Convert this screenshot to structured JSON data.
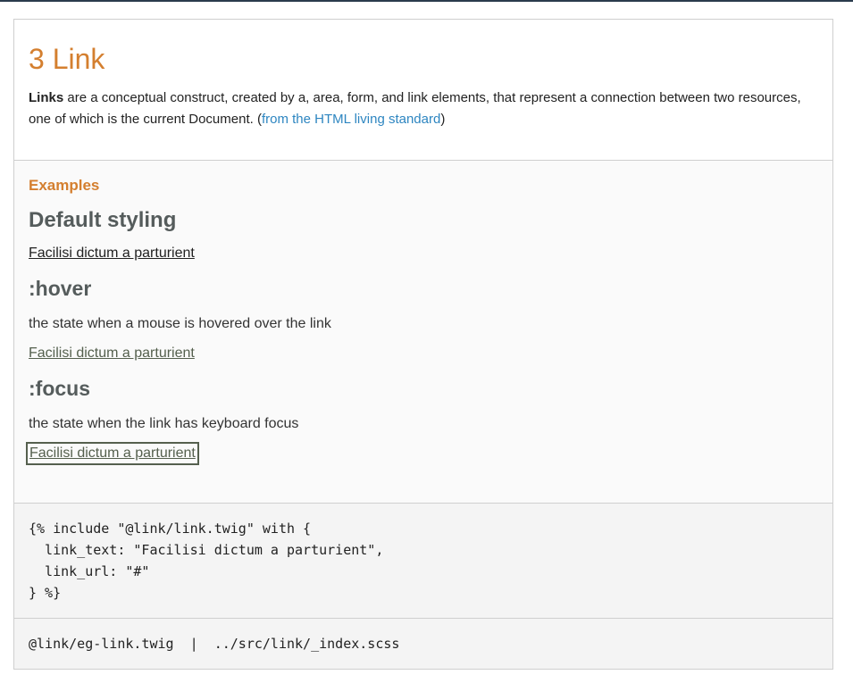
{
  "intro": {
    "title": "3 Link",
    "term": "Links",
    "description": " are a conceptual construct, created by a, area, form, and link elements, that represent a connection between two resources, one of which is the current Document. (",
    "source_link": "from the HTML living standard",
    "description_end": ")"
  },
  "examples": {
    "label": "Examples",
    "default": {
      "heading": "Default styling",
      "link_text": "Facilisi dictum a parturient"
    },
    "hover": {
      "heading": ":hover",
      "description": "the state when a mouse is hovered over the link",
      "link_text": "Facilisi dictum a parturient"
    },
    "focus": {
      "heading": ":focus",
      "description": "the state when the link has keyboard focus",
      "link_text": "Facilisi dictum a parturient"
    }
  },
  "code": {
    "lines": [
      "{% include \"@link/link.twig\" with {",
      "  link_text: \"Facilisi dictum a parturient\",",
      "  link_url: \"#\"",
      "} %}"
    ]
  },
  "footer": {
    "template_path": "@link/eg-link.twig",
    "separator": "|",
    "scss_path": "../src/link/_index.scss"
  }
}
